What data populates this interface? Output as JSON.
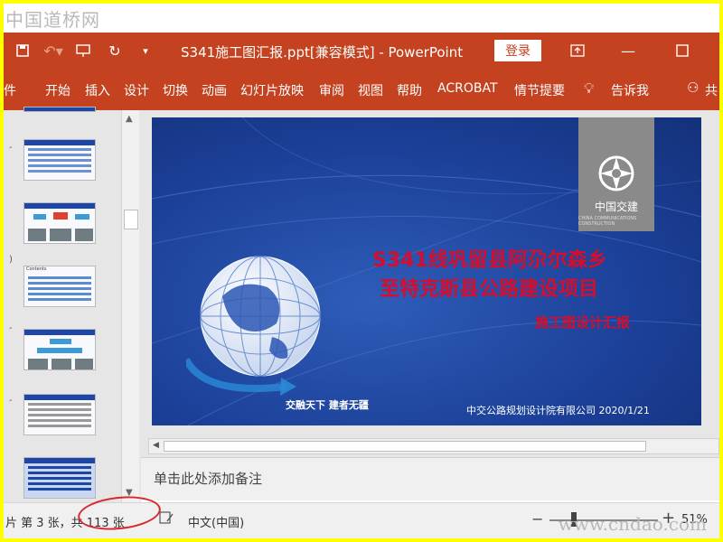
{
  "watermark": {
    "top": "中国道桥网",
    "bottom": "www.cndao.com"
  },
  "titlebar": {
    "title": "S341施工图汇报.ppt[兼容模式]  -  PowerPoint",
    "login": "登录"
  },
  "ribbon": {
    "tabs": [
      "件",
      "开始",
      "插入",
      "设计",
      "切换",
      "动画",
      "幻灯片放映",
      "审阅",
      "视图",
      "帮助",
      "ACROBAT",
      "情节提要",
      "告诉我",
      "共"
    ]
  },
  "thumb_marks": [
    "-",
    ")",
    "-",
    "-"
  ],
  "slide": {
    "logo_name": "中国交建",
    "logo_sub": "CHINA COMMUNICATIONS CONSTRUCTION",
    "title_line1": "S341线巩留县阿尕尔森乡",
    "title_line2": "至特克斯县公路建设项目",
    "subtitle": "施工图设计汇报",
    "slogan": "交融天下  建者无疆",
    "company": "中交公路规划设计院有限公司  2020/1/21"
  },
  "notes": {
    "placeholder": "单击此处添加备注"
  },
  "status": {
    "slide_info": "片 第 3 张，共 113 张",
    "language": "中文(中国)",
    "zoom": "51%",
    "zoom_minus": "−",
    "zoom_plus": "+"
  },
  "colors": {
    "accent": "#c4421f",
    "slide_bg": "#1b3f97",
    "title_red": "#d40e2c",
    "highlight": "#d8262a",
    "frame": "#ffff00"
  }
}
